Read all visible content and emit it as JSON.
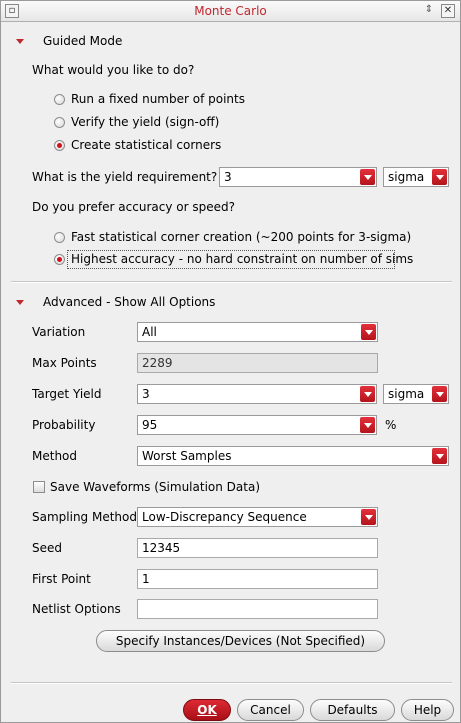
{
  "window": {
    "title": "Monte Carlo",
    "left_glyph": "▫",
    "min_glyph": "⇕",
    "close_glyph": "✕"
  },
  "guided": {
    "section_label": "Guided Mode",
    "question": "What would you like to do?",
    "options": [
      {
        "label": "Run a fixed number of points",
        "selected": false
      },
      {
        "label": "Verify the yield (sign-off)",
        "selected": false
      },
      {
        "label": "Create statistical corners",
        "selected": true
      }
    ],
    "yield_label": "What is the yield requirement?",
    "yield_value": "3",
    "yield_unit": "sigma",
    "accuracy_question": "Do you prefer accuracy or speed?",
    "accuracy_options": [
      {
        "label": "Fast statistical corner creation (~200 points for 3-sigma)",
        "selected": false
      },
      {
        "label": "Highest accuracy - no hard constraint on number of sims",
        "selected": true
      }
    ]
  },
  "advanced": {
    "section_label": "Advanced - Show All Options",
    "variation_label": "Variation",
    "variation_value": "All",
    "max_points_label": "Max Points",
    "max_points_value": "2289",
    "target_yield_label": "Target Yield",
    "target_yield_value": "3",
    "target_yield_unit": "sigma",
    "probability_label": "Probability",
    "probability_value": "95",
    "probability_unit": "%",
    "method_label": "Method",
    "method_value": "Worst Samples",
    "save_waveforms_label": "Save Waveforms (Simulation Data)",
    "save_waveforms_checked": false,
    "sampling_label": "Sampling Method",
    "sampling_value": "Low-Discrepancy Sequence",
    "seed_label": "Seed",
    "seed_value": "12345",
    "first_point_label": "First Point",
    "first_point_value": "1",
    "netlist_label": "Netlist Options",
    "netlist_value": "",
    "specify_button": "Specify Instances/Devices (Not Specified)"
  },
  "footer": {
    "ok": "OK",
    "cancel": "Cancel",
    "defaults": "Defaults",
    "help": "Help"
  },
  "colors": {
    "accent": "#c1272d",
    "background": "#efefef"
  }
}
